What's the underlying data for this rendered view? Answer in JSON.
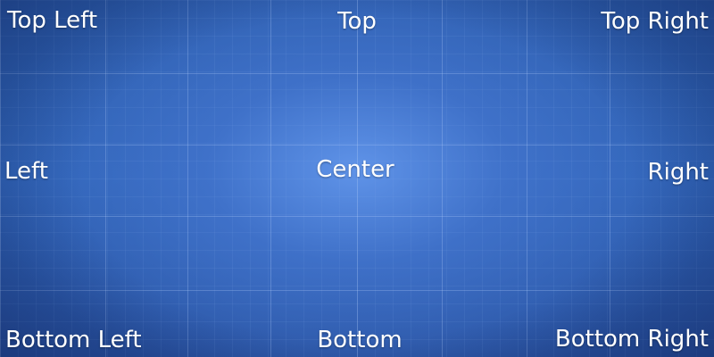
{
  "labels": {
    "top_left": "Top Left",
    "top": "Top",
    "top_right": "Top Right",
    "left": "Left",
    "center": "Center",
    "right": "Right",
    "bottom_left": "Bottom Left",
    "bottom": "Bottom",
    "bottom_right": "Bottom Right"
  },
  "colors": {
    "background": "#2f63b6",
    "background_center": "#5f93e8",
    "grid_line": "#9cc0f5",
    "text": "#ffffff"
  }
}
